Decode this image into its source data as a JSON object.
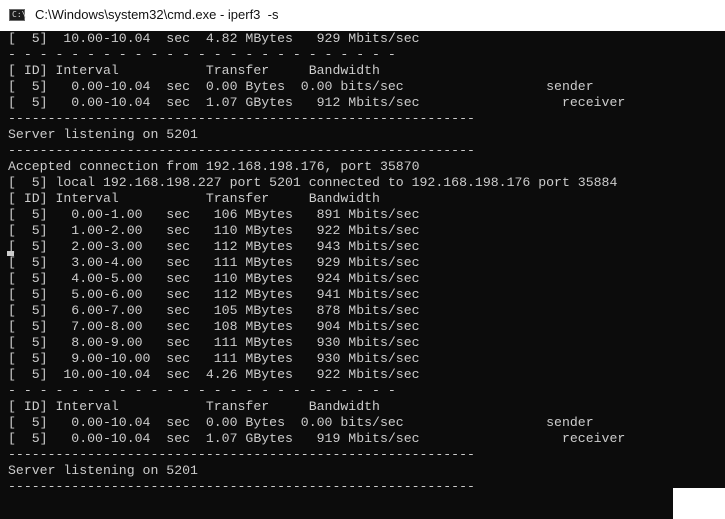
{
  "window": {
    "title": "C:\\Windows\\system32\\cmd.exe - iperf3  -s",
    "icon": "cmd-icon"
  },
  "console": {
    "lines": [
      "[  5]  10.00-10.04  sec  4.82 MBytes   929 Mbits/sec",
      "- - - - - - - - - - - - - - - - - - - - - - - - -",
      "[ ID] Interval           Transfer     Bandwidth",
      "[  5]   0.00-10.04  sec  0.00 Bytes  0.00 bits/sec                  sender",
      "[  5]   0.00-10.04  sec  1.07 GBytes   912 Mbits/sec                  receiver",
      "-----------------------------------------------------------",
      "Server listening on 5201",
      "-----------------------------------------------------------",
      "Accepted connection from 192.168.198.176, port 35870",
      "[  5] local 192.168.198.227 port 5201 connected to 192.168.198.176 port 35884",
      "[ ID] Interval           Transfer     Bandwidth",
      "[  5]   0.00-1.00   sec   106 MBytes   891 Mbits/sec",
      "[  5]   1.00-2.00   sec   110 MBytes   922 Mbits/sec",
      "[  5]   2.00-3.00   sec   112 MBytes   943 Mbits/sec",
      "[  5]   3.00-4.00   sec   111 MBytes   929 Mbits/sec",
      "[  5]   4.00-5.00   sec   110 MBytes   924 Mbits/sec",
      "[  5]   5.00-6.00   sec   112 MBytes   941 Mbits/sec",
      "[  5]   6.00-7.00   sec   105 MBytes   878 Mbits/sec",
      "[  5]   7.00-8.00   sec   108 MBytes   904 Mbits/sec",
      "[  5]   8.00-9.00   sec   111 MBytes   930 Mbits/sec",
      "[  5]   9.00-10.00  sec   111 MBytes   930 Mbits/sec",
      "[  5]  10.00-10.04  sec  4.26 MBytes   922 Mbits/sec",
      "- - - - - - - - - - - - - - - - - - - - - - - - -",
      "[ ID] Interval           Transfer     Bandwidth",
      "[  5]   0.00-10.04  sec  0.00 Bytes  0.00 bits/sec                  sender",
      "[  5]   0.00-10.04  sec  1.07 GBytes   919 Mbits/sec                  receiver",
      "-----------------------------------------------------------",
      "Server listening on 5201",
      "-----------------------------------------------------------"
    ]
  }
}
